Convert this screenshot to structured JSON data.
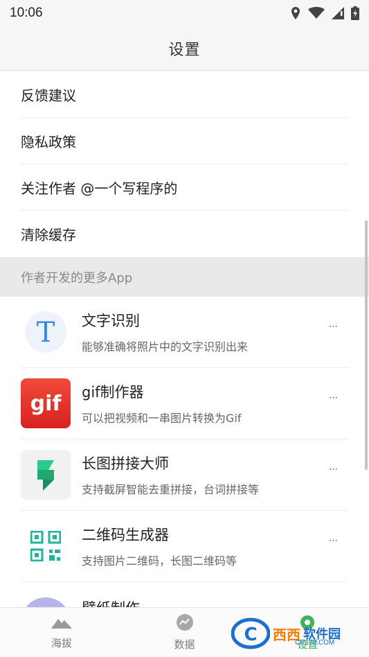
{
  "status_bar": {
    "time": "10:06",
    "icons": [
      "location-icon",
      "wifi-icon",
      "signal-icon",
      "battery-charging-icon"
    ]
  },
  "app_bar": {
    "title": "设置"
  },
  "settings": {
    "items": [
      {
        "label": "反馈建议"
      },
      {
        "label": "隐私政策"
      },
      {
        "label": "关注作者 @一个写程序的"
      },
      {
        "label": "清除缓存"
      }
    ]
  },
  "more_apps": {
    "header": "作者开发的更多App",
    "more_glyph": "⋯",
    "items": [
      {
        "name": "文字识别",
        "desc": "能够准确将照片中的文字识别出来",
        "icon": "text-recognition-icon",
        "icon_letter": "T"
      },
      {
        "name": "gif制作器",
        "desc": "可以把视频和一串图片转换为Gif",
        "icon": "gif-maker-icon",
        "icon_letter": "gif"
      },
      {
        "name": "长图拼接大师",
        "desc": "支持截屏智能去重拼接，台词拼接等",
        "icon": "long-image-stitch-icon"
      },
      {
        "name": "二维码生成器",
        "desc": "支持图片二维码，长图二维码等",
        "icon": "qr-code-generator-icon"
      },
      {
        "name": "壁纸制作",
        "desc": "",
        "icon": "wallpaper-maker-icon"
      }
    ]
  },
  "bottom_nav": {
    "items": [
      {
        "label": "海拔",
        "icon": "mountain-icon",
        "active": false
      },
      {
        "label": "数据",
        "icon": "chart-icon",
        "active": false
      },
      {
        "label": "设置",
        "icon": "settings-icon",
        "active": true
      }
    ]
  },
  "watermark": {
    "brand": "西西",
    "sub": "软件园",
    "url": "CR173.COM"
  },
  "colors": {
    "accent": "#3db35a",
    "gif_red": "#e53935",
    "qr_teal": "#1fb39a",
    "stitch_green": "#21b573"
  }
}
